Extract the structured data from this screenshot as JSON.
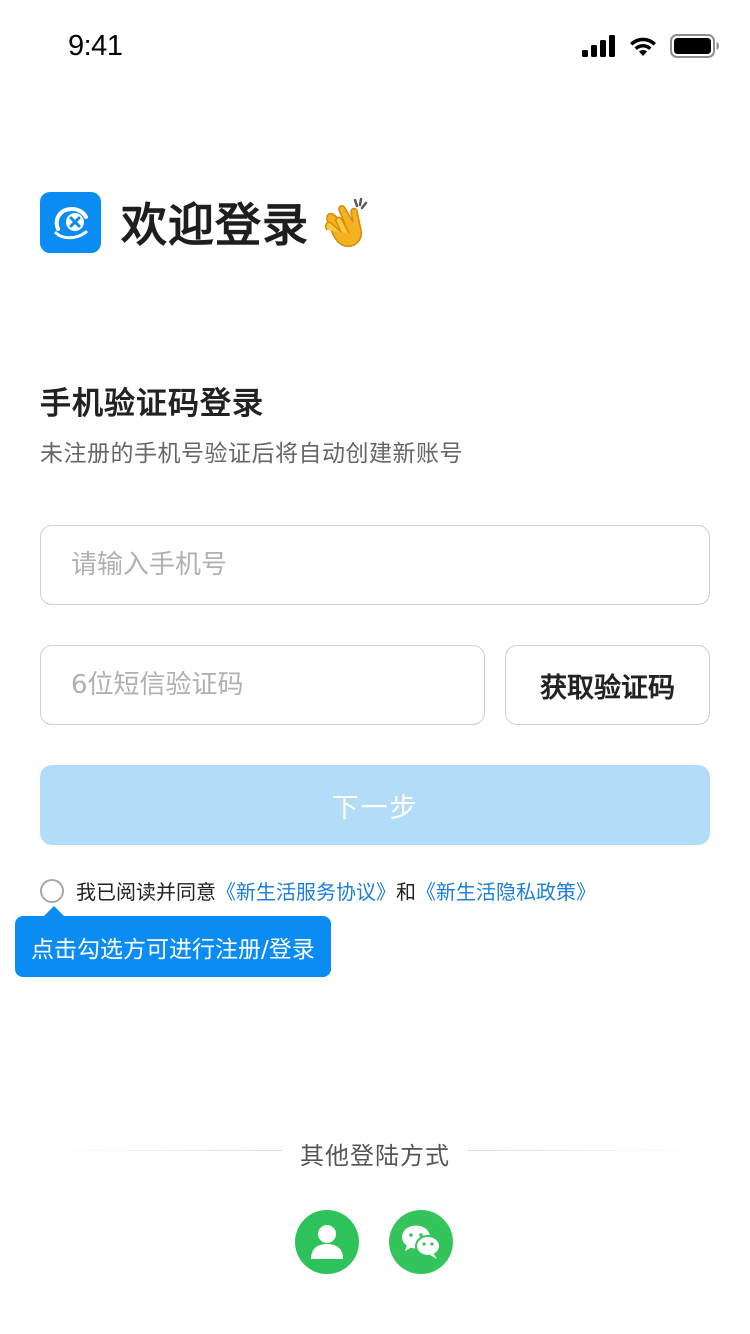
{
  "status_bar": {
    "time": "9:41"
  },
  "header": {
    "welcome_title": "欢迎登录"
  },
  "login": {
    "section_title": "手机验证码登录",
    "subtitle": "未注册的手机号验证后将自动创建新账号",
    "phone_placeholder": "请输入手机号",
    "code_placeholder": "6位短信验证码",
    "get_code_label": "获取验证码",
    "next_label": "下一步"
  },
  "agreement": {
    "prefix": "我已阅读并同意",
    "service_link": "《新生活服务协议》",
    "and": "和",
    "privacy_link": "《新生活隐私政策》",
    "tooltip": "点击勾选方可进行注册/登录"
  },
  "other_login": {
    "label": "其他登陆方式",
    "options": [
      "user-icon",
      "wechat-icon"
    ]
  },
  "colors": {
    "accent": "#0b8cf3",
    "next_disabled": "#b2dcf8",
    "link": "#1a7fd8",
    "social_green": "#2ec35a"
  }
}
